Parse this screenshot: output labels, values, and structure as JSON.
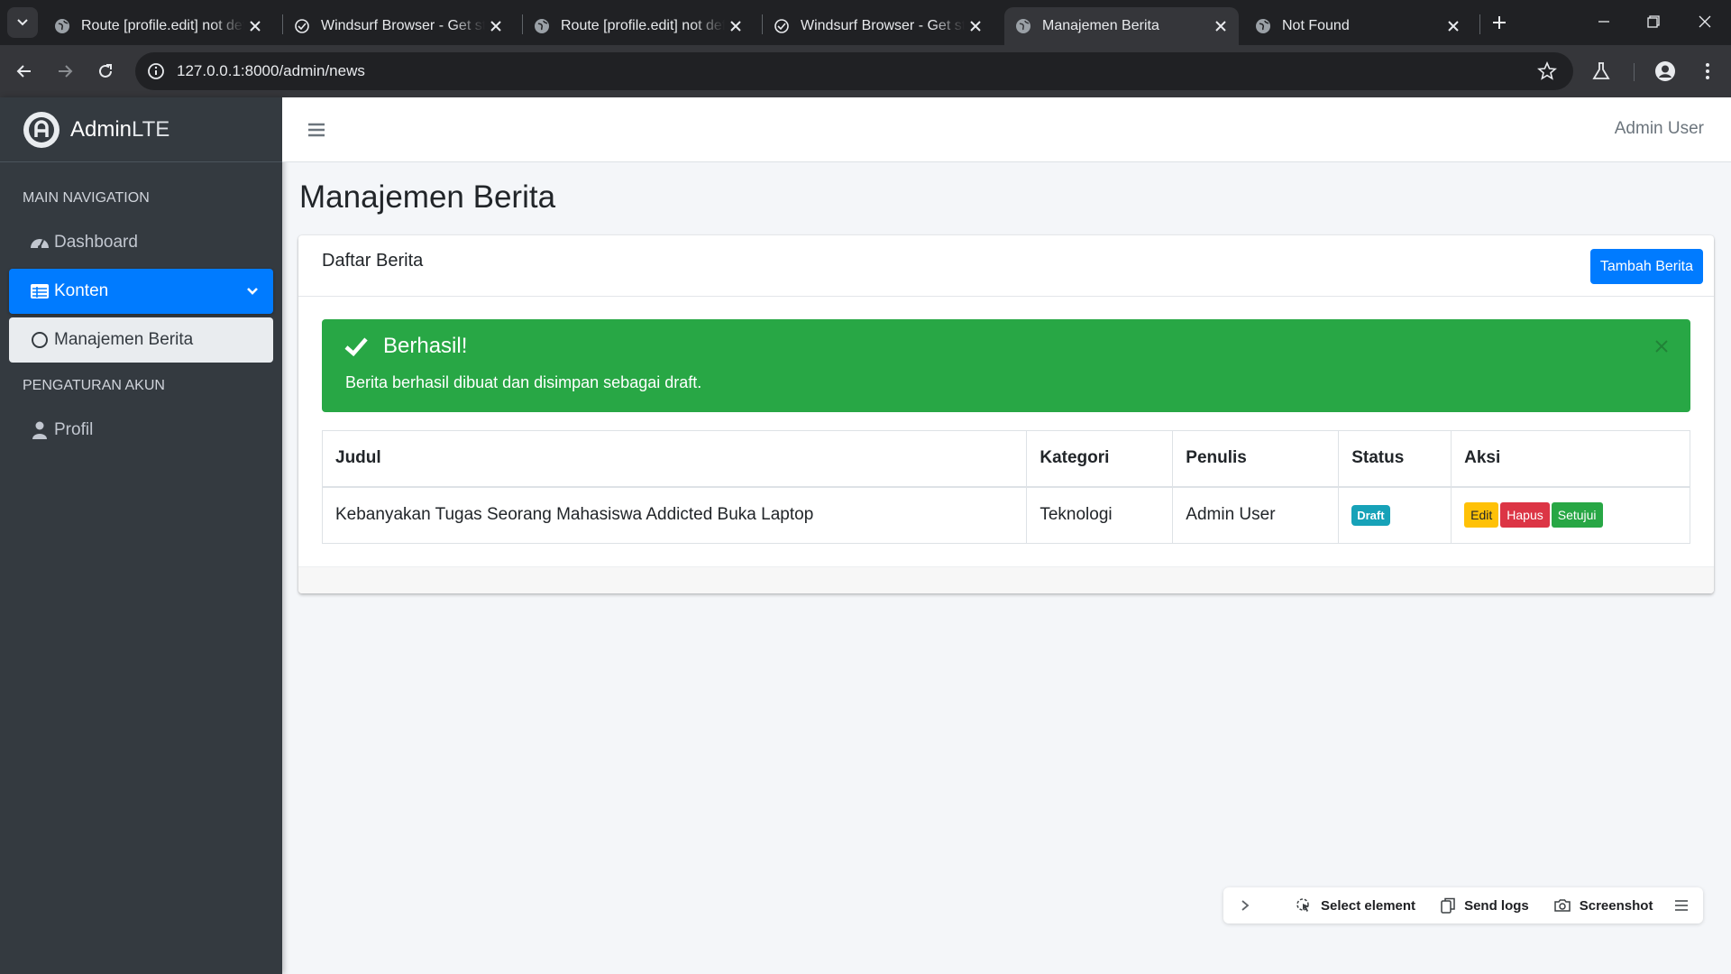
{
  "browser": {
    "tabs": [
      {
        "title": "Route [profile.edit] not defined",
        "active": false
      },
      {
        "title": "Windsurf Browser - Get started",
        "active": false
      },
      {
        "title": "Route [profile.edit] not defined",
        "active": false
      },
      {
        "title": "Windsurf Browser - Get started",
        "active": false
      },
      {
        "title": "Manajemen Berita",
        "active": true
      },
      {
        "title": "Not Found",
        "active": false
      }
    ],
    "url": "127.0.0.1:8000/admin/news"
  },
  "sidebar": {
    "brand_bold": "Admin",
    "brand_light": "LTE",
    "header_main": "MAIN NAVIGATION",
    "dashboard": "Dashboard",
    "konten": "Konten",
    "manajemen_berita": "Manajemen Berita",
    "header_account": "PENGATURAN AKUN",
    "profil": "Profil"
  },
  "header": {
    "user_name": "Admin User"
  },
  "page": {
    "title": "Manajemen Berita"
  },
  "card": {
    "title": "Daftar Berita",
    "add_button": "Tambah Berita"
  },
  "alert": {
    "title": "Berhasil!",
    "message": "Berita berhasil dibuat dan disimpan sebagai draft.",
    "color": "#28a745"
  },
  "table": {
    "headers": [
      "Judul",
      "Kategori",
      "Penulis",
      "Status",
      "Aksi"
    ],
    "rows": [
      {
        "judul": "Kebanyakan Tugas Seorang Mahasiswa Addicted Buka Laptop",
        "kategori": "Teknologi",
        "penulis": "Admin User",
        "status": "Draft",
        "actions": {
          "edit": "Edit",
          "hapus": "Hapus",
          "setujui": "Setujui"
        }
      }
    ]
  },
  "devtools": {
    "select_element": "Select element",
    "send_logs": "Send logs",
    "screenshot": "Screenshot"
  },
  "colors": {
    "primary": "#007bff",
    "sidebar": "#343a40",
    "success": "#28a745",
    "info": "#17a2b8",
    "warning": "#ffc107",
    "danger": "#dc3545"
  }
}
